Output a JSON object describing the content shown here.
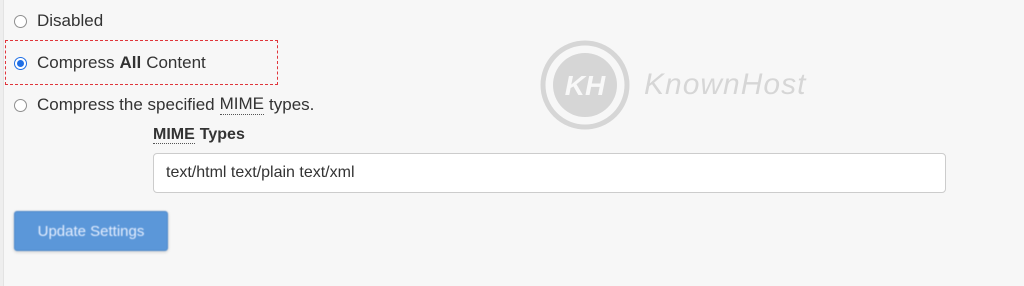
{
  "compression": {
    "options": [
      {
        "label": "Disabled",
        "selected": false
      },
      {
        "label_pre": "Compress",
        "label_bold": "All",
        "label_post": "Content",
        "selected": true
      },
      {
        "label_pre": "Compress the specified",
        "label_abbr": "MIME",
        "label_post": "types.",
        "selected": false
      }
    ],
    "mime_types": {
      "label_abbr": "MIME",
      "label_rest": "Types",
      "value": "text/html text/plain text/xml"
    },
    "update_button_label": "Update Settings"
  },
  "watermark": {
    "monogram": "KH",
    "text": "KnownHost"
  },
  "colors": {
    "accent": "#1f6fe5",
    "highlight": "#e0353b",
    "button": "#5b97d9"
  }
}
